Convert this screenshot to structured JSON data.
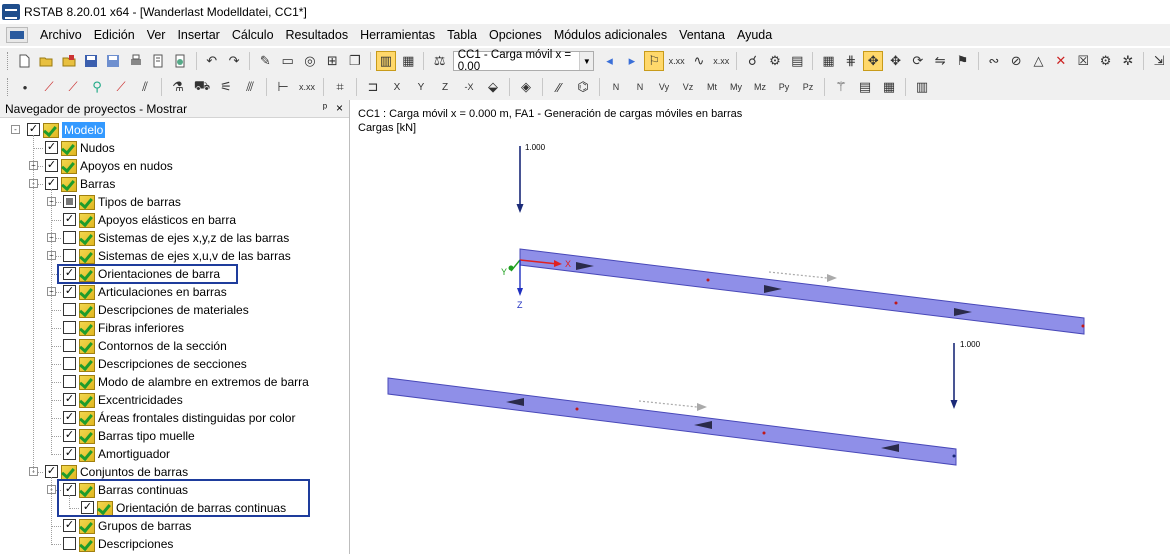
{
  "window": {
    "title": "RSTAB 8.20.01 x64 - [Wanderlast Modelldatei, CC1*]"
  },
  "menu": {
    "items": [
      "Archivo",
      "Edición",
      "Ver",
      "Insertar",
      "Cálculo",
      "Resultados",
      "Herramientas",
      "Tabla",
      "Opciones",
      "Módulos adicionales",
      "Ventana",
      "Ayuda"
    ]
  },
  "toolbar": {
    "load_case_selected": "CC1 - Carga móvil x = 0.00"
  },
  "navigator": {
    "title": "Navegador de proyectos - Mostrar",
    "pin_glyph": "ᵖ",
    "close_glyph": "×",
    "items": [
      {
        "label": "Modelo",
        "level": 0,
        "expander": "-",
        "check": "checked",
        "selected": true
      },
      {
        "label": "Nudos",
        "level": 1,
        "expander": "",
        "check": "checked"
      },
      {
        "label": "Apoyos en nudos",
        "level": 1,
        "expander": "+",
        "check": "checked"
      },
      {
        "label": "Barras",
        "level": 1,
        "expander": "-",
        "check": "checked"
      },
      {
        "label": "Tipos de barras",
        "level": 2,
        "expander": "+",
        "check": "partial"
      },
      {
        "label": "Apoyos elásticos en barra",
        "level": 2,
        "expander": "",
        "check": "checked"
      },
      {
        "label": "Sistemas de ejes x,y,z de las barras",
        "level": 2,
        "expander": "+",
        "check": "unchecked"
      },
      {
        "label": "Sistemas de ejes x,u,v de las barras",
        "level": 2,
        "expander": "+",
        "check": "unchecked"
      },
      {
        "label": "Orientaciones de barra",
        "level": 2,
        "expander": "",
        "check": "checked"
      },
      {
        "label": "Articulaciones en barras",
        "level": 2,
        "expander": "+",
        "check": "checked"
      },
      {
        "label": "Descripciones de materiales",
        "level": 2,
        "expander": "",
        "check": "unchecked"
      },
      {
        "label": "Fibras inferiores",
        "level": 2,
        "expander": "",
        "check": "unchecked"
      },
      {
        "label": "Contornos de la sección",
        "level": 2,
        "expander": "",
        "check": "unchecked"
      },
      {
        "label": "Descripciones de secciones",
        "level": 2,
        "expander": "",
        "check": "unchecked"
      },
      {
        "label": "Modo de alambre en extremos de barra",
        "level": 2,
        "expander": "",
        "check": "unchecked"
      },
      {
        "label": "Excentricidades",
        "level": 2,
        "expander": "",
        "check": "checked"
      },
      {
        "label": "Áreas frontales distinguidas por color",
        "level": 2,
        "expander": "",
        "check": "checked"
      },
      {
        "label": "Barras tipo muelle",
        "level": 2,
        "expander": "",
        "check": "checked"
      },
      {
        "label": "Amortiguador",
        "level": 2,
        "expander": "",
        "check": "checked"
      },
      {
        "label": "Conjuntos de barras",
        "level": 1,
        "expander": "-",
        "check": "checked"
      },
      {
        "label": "Barras continuas",
        "level": 2,
        "expander": "-",
        "check": "checked"
      },
      {
        "label": "Orientación de barras continuas",
        "level": 3,
        "expander": "",
        "check": "checked"
      },
      {
        "label": "Grupos de barras",
        "level": 2,
        "expander": "",
        "check": "checked"
      },
      {
        "label": "Descripciones",
        "level": 2,
        "expander": "",
        "check": "unchecked"
      }
    ]
  },
  "canvas": {
    "info_line1": "CC1 : Carga móvil x = 0.000 m, FA1 -  Generación de cargas móviles en barras",
    "info_line2": "Cargas [kN]",
    "load1_value": "1.000",
    "load2_value": "1.000",
    "axis_x": "X",
    "axis_y": "Y",
    "axis_z": "Z"
  },
  "colors": {
    "member_fill": "#8f8fe8",
    "member_edge": "#4848b8",
    "load_arrow": "#1b2a78",
    "axis_x": "#e02020",
    "axis_y": "#20a020",
    "axis_z": "#2030c0",
    "highlight_box": "#1e3c9c"
  }
}
